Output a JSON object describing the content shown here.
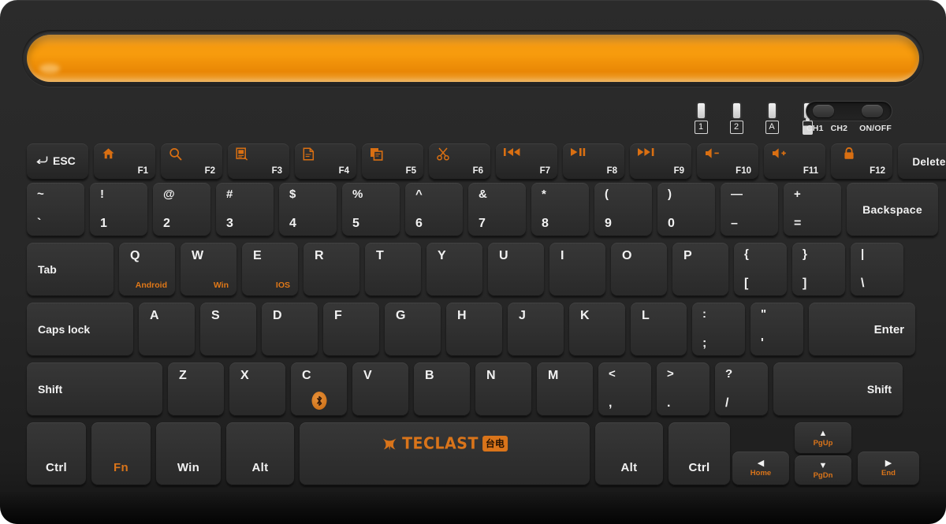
{
  "product": {
    "brand": "TECLAST",
    "brand_cn": "台电",
    "accent_color": "#d9741a",
    "groove_color": "#f59a12",
    "body_color": "#2b2b2b"
  },
  "indicators": [
    {
      "name": "channel-1",
      "label": "1",
      "type": "box"
    },
    {
      "name": "channel-2",
      "label": "2",
      "type": "box"
    },
    {
      "name": "caps-lock",
      "label": "A",
      "type": "box"
    },
    {
      "name": "battery",
      "label": "",
      "type": "battery"
    }
  ],
  "switches": {
    "channel_left": "CH1",
    "channel_right": "CH2",
    "power": "ON/OFF"
  },
  "rows": {
    "function": [
      {
        "name": "esc",
        "legend": "ESC",
        "glyph": "return-arrow-icon",
        "fnum": ""
      },
      {
        "name": "f1",
        "legend": "F1",
        "glyph": "home-icon"
      },
      {
        "name": "f2",
        "legend": "F2",
        "glyph": "search-icon"
      },
      {
        "name": "f3",
        "legend": "F3",
        "glyph": "screenshot-icon"
      },
      {
        "name": "f4",
        "legend": "F4",
        "glyph": "document-icon"
      },
      {
        "name": "f5",
        "legend": "F5",
        "glyph": "copy-icon"
      },
      {
        "name": "f6",
        "legend": "F6",
        "glyph": "scissors-icon"
      },
      {
        "name": "f7",
        "legend": "F7",
        "glyph": "previous-track-icon"
      },
      {
        "name": "f8",
        "legend": "F8",
        "glyph": "play-pause-icon"
      },
      {
        "name": "f9",
        "legend": "F9",
        "glyph": "next-track-icon"
      },
      {
        "name": "f10",
        "legend": "F10",
        "glyph": "volume-down-icon"
      },
      {
        "name": "f11",
        "legend": "F11",
        "glyph": "volume-up-icon"
      },
      {
        "name": "f12",
        "legend": "F12",
        "glyph": "lock-icon"
      },
      {
        "name": "delete",
        "legend": "Delete",
        "glyph": ""
      }
    ],
    "number": [
      {
        "name": "backtick",
        "top": "~",
        "bot": "`"
      },
      {
        "name": "digit-1",
        "top": "!",
        "bot": "1"
      },
      {
        "name": "digit-2",
        "top": "@",
        "bot": "2"
      },
      {
        "name": "digit-3",
        "top": "#",
        "bot": "3"
      },
      {
        "name": "digit-4",
        "top": "$",
        "bot": "4"
      },
      {
        "name": "digit-5",
        "top": "%",
        "bot": "5"
      },
      {
        "name": "digit-6",
        "top": "^",
        "bot": "6"
      },
      {
        "name": "digit-7",
        "top": "&",
        "bot": "7"
      },
      {
        "name": "digit-8",
        "top": "*",
        "bot": "8"
      },
      {
        "name": "digit-9",
        "top": "(",
        "bot": "9"
      },
      {
        "name": "digit-0",
        "top": ")",
        "bot": "0"
      },
      {
        "name": "minus",
        "top": "—",
        "bot": "–"
      },
      {
        "name": "equals",
        "top": "+",
        "bot": "="
      }
    ],
    "backspace": "Backspace",
    "qwerty": [
      {
        "name": "tab",
        "label": "Tab"
      },
      {
        "name": "key-q",
        "label": "Q",
        "sub": "Android"
      },
      {
        "name": "key-w",
        "label": "W",
        "sub": "Win"
      },
      {
        "name": "key-e",
        "label": "E",
        "sub": "IOS"
      },
      {
        "name": "key-r",
        "label": "R",
        "sub": ""
      },
      {
        "name": "key-t",
        "label": "T",
        "sub": ""
      },
      {
        "name": "key-y",
        "label": "Y",
        "sub": ""
      },
      {
        "name": "key-u",
        "label": "U",
        "sub": ""
      },
      {
        "name": "key-i",
        "label": "I",
        "sub": ""
      },
      {
        "name": "key-o",
        "label": "O",
        "sub": ""
      },
      {
        "name": "key-p",
        "label": "P",
        "sub": ""
      },
      {
        "name": "bracket-left",
        "top": "{",
        "bot": "["
      },
      {
        "name": "bracket-right",
        "top": "}",
        "bot": "]"
      },
      {
        "name": "backslash",
        "top": "|",
        "bot": "\\"
      }
    ],
    "home": [
      {
        "name": "caps-lock",
        "label": "Caps lock"
      },
      {
        "name": "key-a",
        "label": "A"
      },
      {
        "name": "key-s",
        "label": "S"
      },
      {
        "name": "key-d",
        "label": "D"
      },
      {
        "name": "key-f",
        "label": "F"
      },
      {
        "name": "key-g",
        "label": "G"
      },
      {
        "name": "key-h",
        "label": "H"
      },
      {
        "name": "key-j",
        "label": "J"
      },
      {
        "name": "key-k",
        "label": "K"
      },
      {
        "name": "key-l",
        "label": "L"
      },
      {
        "name": "semicolon",
        "top": ":",
        "bot": ";"
      },
      {
        "name": "quote",
        "top": "\"",
        "bot": "'"
      },
      {
        "name": "enter",
        "label": "Enter"
      }
    ],
    "shift": [
      {
        "name": "shift-left",
        "label": "Shift"
      },
      {
        "name": "key-z",
        "label": "Z"
      },
      {
        "name": "key-x",
        "label": "X"
      },
      {
        "name": "key-c",
        "label": "C",
        "badge": "bluetooth-icon"
      },
      {
        "name": "key-v",
        "label": "V"
      },
      {
        "name": "key-b",
        "label": "B"
      },
      {
        "name": "key-n",
        "label": "N"
      },
      {
        "name": "key-m",
        "label": "M"
      },
      {
        "name": "comma",
        "top": "<",
        "bot": ","
      },
      {
        "name": "period",
        "top": ">",
        "bot": "."
      },
      {
        "name": "slash",
        "top": "?",
        "bot": "/"
      },
      {
        "name": "shift-right",
        "label": "Shift"
      }
    ],
    "bottom": [
      {
        "name": "ctrl-left",
        "label": "Ctrl"
      },
      {
        "name": "fn",
        "label": "Fn"
      },
      {
        "name": "win",
        "label": "Win"
      },
      {
        "name": "alt-left",
        "label": "Alt"
      },
      {
        "name": "spacebar",
        "label": ""
      },
      {
        "name": "alt-right",
        "label": "Alt"
      },
      {
        "name": "ctrl-right",
        "label": "Ctrl"
      }
    ],
    "arrows": [
      {
        "name": "arrow-left",
        "glyph": "◀",
        "caption": "Home"
      },
      {
        "name": "arrow-up",
        "glyph": "▲",
        "caption": "PgUp"
      },
      {
        "name": "arrow-down",
        "glyph": "▼",
        "caption": "PgDn"
      },
      {
        "name": "arrow-right",
        "glyph": "▶",
        "caption": "End"
      }
    ]
  }
}
